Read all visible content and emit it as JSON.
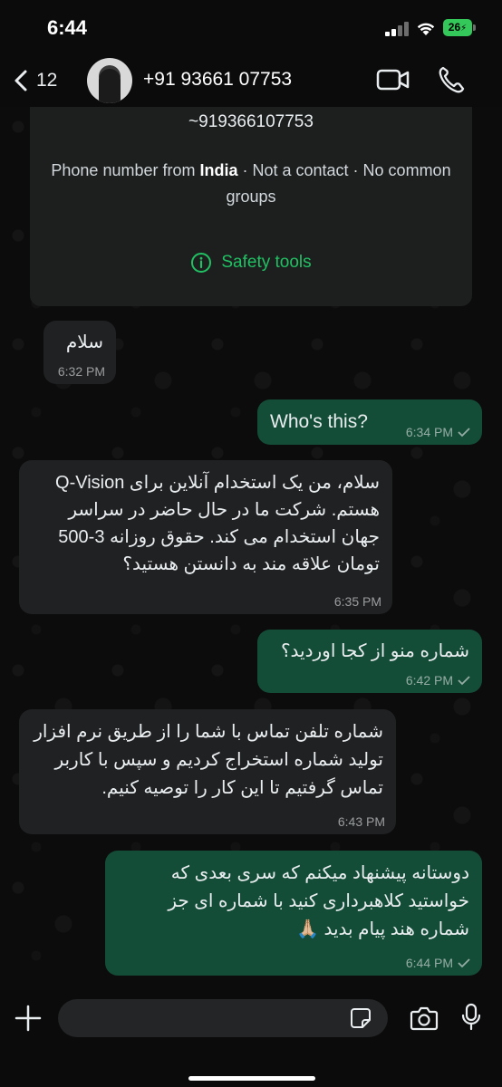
{
  "status_bar": {
    "time": "6:44",
    "battery": "26",
    "battery_color": "#34c759"
  },
  "header": {
    "back_count": "12",
    "contact_name": "+91 93661 07753",
    "icons": [
      "chevron-left-icon",
      "video-camera-icon",
      "phone-icon"
    ]
  },
  "info_card": {
    "number": "~919366107753",
    "desc_prefix": "Phone number from ",
    "country": "India",
    "desc_suffix": " · Not a contact · No common groups",
    "safety_label": "Safety tools",
    "accent": "#21c063"
  },
  "messages": [
    {
      "direction": "in",
      "text": "سلام",
      "time": "6:32 PM"
    },
    {
      "direction": "out",
      "text": "Who's this?",
      "time": "6:34 PM"
    },
    {
      "direction": "in",
      "text": "سلام، من یک استخدام آنلاین برای Q-Vision هستم. شرکت ما در حال حاضر در سراسر جهان استخدام می کند. حقوق روزانه 3-500 تومان علاقه مند به دانستن هستید؟",
      "time": "6:35 PM"
    },
    {
      "direction": "out",
      "text": "شماره منو از کجا اوردید؟",
      "time": "6:42 PM"
    },
    {
      "direction": "in",
      "text": "شماره تلفن تماس با شما را از طریق نرم افزار تولید شماره استخراج کردیم و سپس با کاربر تماس گرفتیم تا این کار را توصیه کنیم.",
      "time": "6:43 PM"
    },
    {
      "direction": "out",
      "text": "دوستانه پیشنهاد میکنم که سری بعدی که خواستید کلاهبرداری کنید با شماره ای جز شماره هند پیام بدید 🙏🏼",
      "time": "6:44 PM"
    }
  ],
  "input_bar": {
    "placeholder": "",
    "icons": [
      "plus-icon",
      "sticker-icon",
      "camera-icon",
      "microphone-icon"
    ]
  },
  "colors": {
    "incoming_bubble": "#202123",
    "outgoing_bubble": "#144d37",
    "background": "#0b0b0b"
  }
}
